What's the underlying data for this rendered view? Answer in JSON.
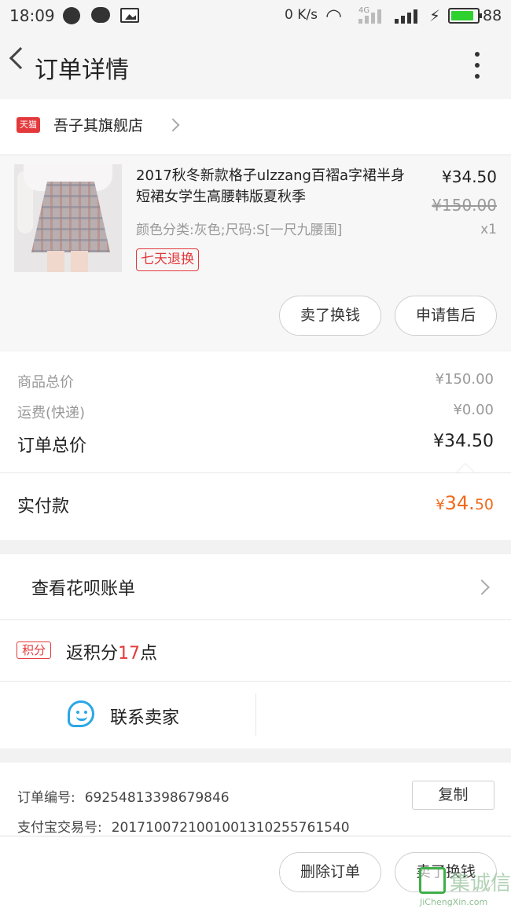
{
  "status_bar": {
    "time": "18:09",
    "net_speed": "0 K/s",
    "net_type": "4G",
    "battery_percent": "88",
    "battery_level": 0.88
  },
  "nav": {
    "title": "订单详情"
  },
  "shop": {
    "badge": "天猫",
    "name": "吾子其旗舰店"
  },
  "product": {
    "title": "2017秋冬新款格子ulzzang百褶a字裙半身短裙女学生高腰韩版夏秋季",
    "sku": "颜色分类:灰色;尺码:S[一尺九腰围]",
    "price": "¥34.50",
    "original_price": "¥150.00",
    "quantity": "x1",
    "return_badge": "七天退换"
  },
  "product_actions": {
    "sell_button": "卖了换钱",
    "after_sale_button": "申请售后"
  },
  "summary": {
    "goods_total_label": "商品总价",
    "goods_total_value": "¥150.00",
    "shipping_label": "运费(快递)",
    "shipping_value": "¥0.00",
    "order_total_label": "订单总价",
    "order_total_value": "¥34.50",
    "paid_label": "实付款",
    "paid_currency": "¥",
    "paid_main": "34.",
    "paid_cents": "50"
  },
  "huabei": {
    "label": "查看花呗账单"
  },
  "points": {
    "badge": "积分",
    "prefix": "返积分",
    "count": "17",
    "suffix": "点"
  },
  "contact": {
    "label": "联系卖家"
  },
  "order_info": {
    "order_no_label": "订单编号:",
    "order_no_value": "69254813398679846",
    "alipay_label": "支付宝交易号:",
    "alipay_value": "2017100721001001310255761540",
    "copy_button": "复制"
  },
  "bottom_bar": {
    "delete_button": "删除订单",
    "sell_button": "卖了换钱"
  },
  "watermark": {
    "text": "集诚信",
    "sub": "JiChengXin.com"
  },
  "colors": {
    "accent_red": "#e4393c",
    "paid_orange": "#f06a1c",
    "contact_blue": "#2aa7e6",
    "battery_green": "#2fd12f"
  }
}
